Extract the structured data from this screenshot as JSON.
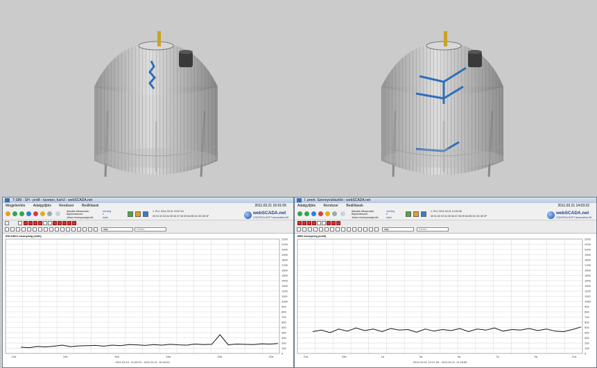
{
  "left_window": {
    "title": "T-SIM - SH - proB - taverpo_fuch2 - webSCADA.net",
    "menu": [
      "Megjelenítés",
      "Adatgyűjtés",
      "Rendszer",
      "Beállítások"
    ],
    "datetime": "2011.03.21 15:01:05",
    "info_labels": [
      "Aktuális felhasználó:",
      "Bejelentkezett:",
      "Jelszó érvényességi idő:"
    ],
    "info_values": [
      "Vendég",
      "0",
      "lejárt"
    ],
    "plc_line": "1. PLC  2011.03.21  15:07:04",
    "channel_line": "00 01 02 03 04 05 06 07 08 09 0A 0B 0C 0D 0E 0F",
    "logo_main": "webSCADA.net",
    "logo_sub": "CONTROLSOFT Automatika Kft",
    "select_value": "alap",
    "field_placeholder": "Görbéz",
    "chart_title": "ESC1/BV1 mennyiség (m3/h)",
    "time_range": "2011.03.10. 13:33:03 - 2011.03.11. 15:16:00",
    "xticks": [
      "12a",
      "14a",
      "16a",
      "18a",
      "20a",
      "22a"
    ]
  },
  "right_window": {
    "title": "I. prent. Szennyvíztisztító - webSCADA.net",
    "menu": [
      "Adatgyűjtés",
      "Rendszer",
      "Beállítások"
    ],
    "datetime": "2011.03.21 14:03:22",
    "info_labels": [
      "Aktuális felhasználó:",
      "Bejelentkezett:",
      "Jelszó érvényességi idő:"
    ],
    "info_values": [
      "Vendég",
      "0",
      "lejárt"
    ],
    "plc_line": "1. PLC  2011.03.21  14:03:26",
    "channel_line": "00 01 02 03 04 05 06 07 08 09 0A 0B 0C 0D 0E 0F",
    "logo_main": "webSCADA.net",
    "logo_sub": "CONTROLSOFT Automatika Kft",
    "select_value": "alap",
    "field_placeholder": "Görbéz",
    "chart_title": "BEH mennyiség (m3/h)",
    "time_range": "2011.03.10. 12:27:33 - 2011.03.11. 11:16:55",
    "xticks": [
      "21a",
      "23a",
      "1a",
      "3a",
      "5a",
      "7a",
      "9a",
      "11a"
    ]
  },
  "chart_data": [
    {
      "type": "line",
      "title": "ESC1/BV1 mennyiség (m3/h)",
      "ylim": [
        0,
        2200
      ],
      "yticks": [
        0,
        100,
        200,
        300,
        400,
        500,
        600,
        700,
        800,
        900,
        1000,
        1100,
        1200,
        1300,
        1400,
        1500,
        1600,
        1700,
        1800,
        1900,
        2000,
        2100,
        2200
      ],
      "series": [
        {
          "values": [
            120,
            110,
            135,
            125,
            140,
            160,
            130,
            145,
            150,
            155,
            140,
            160,
            150,
            170,
            165,
            155,
            170,
            160,
            175,
            165,
            160,
            180,
            170,
            175,
            360,
            165,
            180,
            175,
            170,
            185,
            180,
            190
          ]
        }
      ]
    },
    {
      "type": "line",
      "title": "BEH mennyiség (m3/h)",
      "ylim": [
        0,
        2200
      ],
      "yticks": [
        0,
        100,
        200,
        300,
        400,
        500,
        600,
        700,
        800,
        900,
        1000,
        1100,
        1200,
        1300,
        1400,
        1500,
        1600,
        1700,
        1800,
        1900,
        2000,
        2100,
        2200
      ],
      "series": [
        {
          "values": [
            420,
            450,
            400,
            470,
            430,
            490,
            440,
            470,
            420,
            480,
            450,
            460,
            410,
            470,
            430,
            460,
            440,
            480,
            420,
            470,
            450,
            490,
            430,
            460,
            450,
            480,
            440,
            470,
            430,
            420,
            460,
            510
          ]
        }
      ]
    }
  ]
}
